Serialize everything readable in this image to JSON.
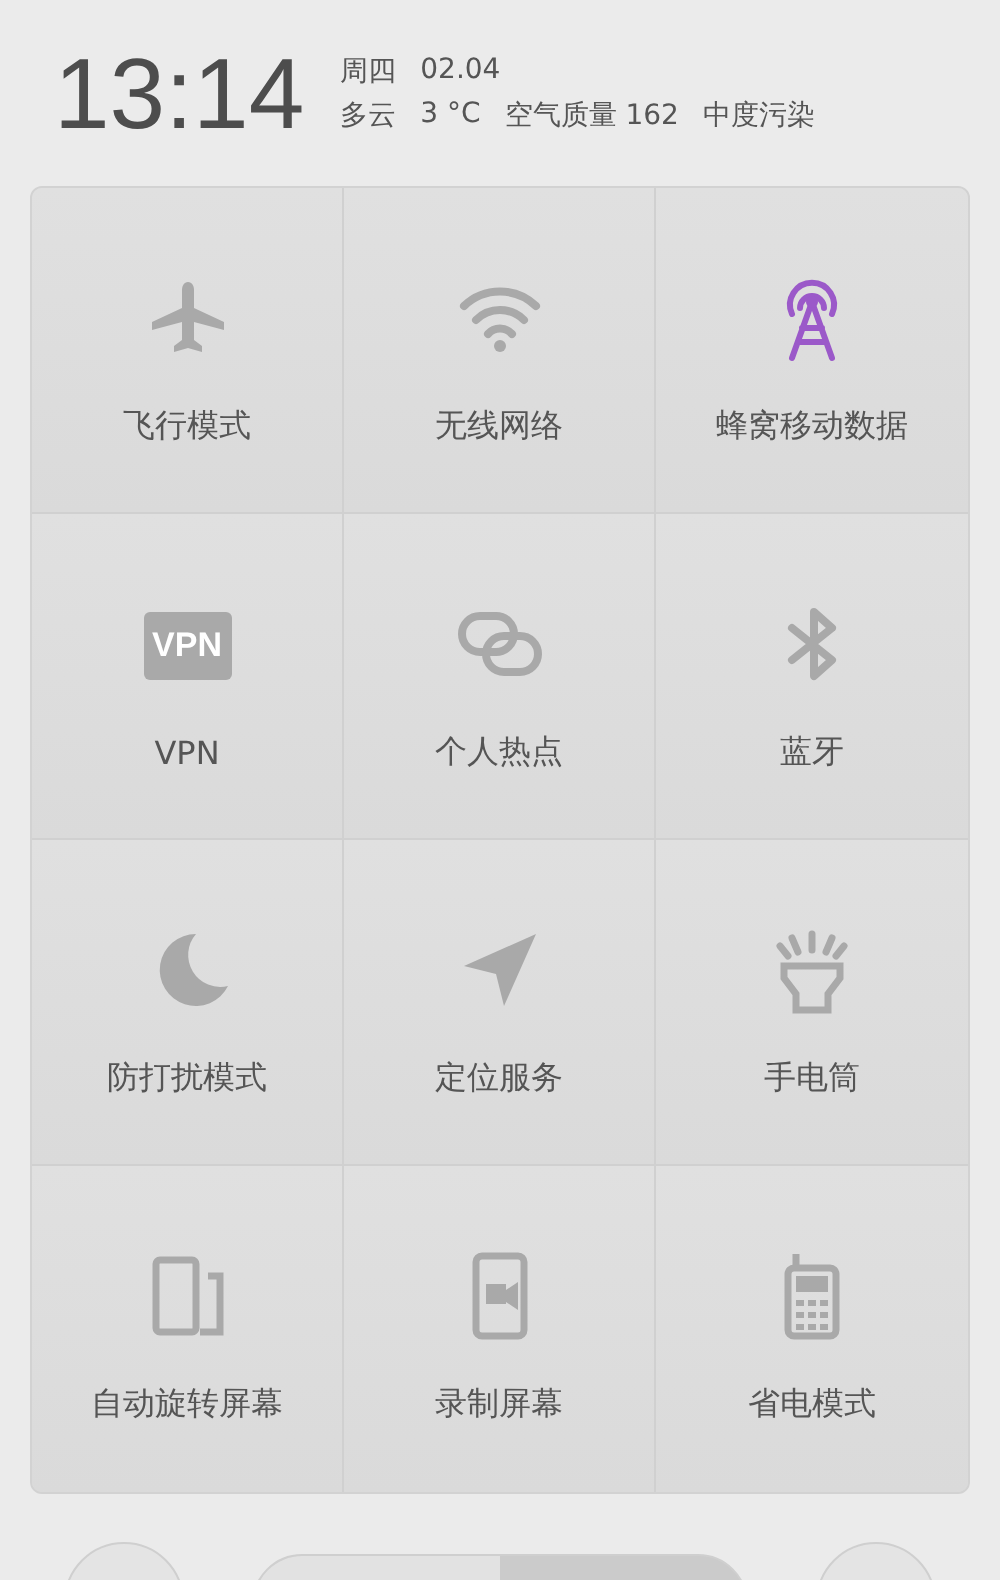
{
  "header": {
    "time": "13:14",
    "weekday": "周四",
    "date": "02.04",
    "weather": "多云",
    "temperature": "3 °C",
    "air_quality": "空气质量 162",
    "pollution": "中度污染"
  },
  "tiles": [
    {
      "label": "飞行模式",
      "kind": "airplane",
      "on": false
    },
    {
      "label": "无线网络",
      "kind": "wifi",
      "on": false
    },
    {
      "label": "蜂窝移动数据",
      "kind": "cellular",
      "on": true
    },
    {
      "label": "VPN",
      "kind": "vpn",
      "on": false,
      "badge": "VPN"
    },
    {
      "label": "个人热点",
      "kind": "hotspot",
      "on": false
    },
    {
      "label": "蓝牙",
      "kind": "bluetooth",
      "on": false
    },
    {
      "label": "防打扰模式",
      "kind": "dnd",
      "on": false
    },
    {
      "label": "定位服务",
      "kind": "location",
      "on": false
    },
    {
      "label": "手电筒",
      "kind": "flashlight",
      "on": false
    },
    {
      "label": "自动旋转屏幕",
      "kind": "rotate",
      "on": false
    },
    {
      "label": "录制屏幕",
      "kind": "record",
      "on": false
    },
    {
      "label": "省电模式",
      "kind": "power",
      "on": false
    }
  ],
  "slider": {
    "level": 0.5
  }
}
